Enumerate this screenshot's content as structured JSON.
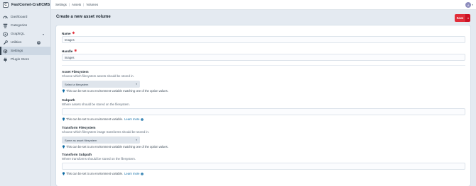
{
  "site": {
    "badge": "C",
    "name": "FastComet-CraftCMS"
  },
  "nav": [
    {
      "label": "Dashboard",
      "icon": "dashboard-icon"
    },
    {
      "label": "Categories",
      "icon": "categories-icon"
    },
    {
      "label": "GraphQL",
      "icon": "graphql-icon"
    },
    {
      "label": "Utilities",
      "icon": "wrench-icon",
      "badge": "3"
    },
    {
      "label": "Settings",
      "icon": "gear-icon"
    },
    {
      "label": "Plugin Store",
      "icon": "plug-icon"
    }
  ],
  "breadcrumbs": [
    "Settings",
    "Assets",
    "Volumes"
  ],
  "user": {
    "initial": "A"
  },
  "page": {
    "title": "Create a new asset volume"
  },
  "actions": {
    "save": "Save"
  },
  "form": {
    "name": {
      "label": "Name",
      "value": "Images"
    },
    "handle": {
      "label": "Handle",
      "value": "images"
    },
    "asset_fs": {
      "label": "Asset Filesystem",
      "instructions": "Choose which filesystem assets should be stored in.",
      "selected": "Select a filesystem",
      "tip": "This can be set to an environment variable matching one of the option values."
    },
    "subpath": {
      "label": "Subpath",
      "instructions": "Where assets should be stored on the filesystem.",
      "value": "",
      "tip": "This can be set to an environment variable.",
      "link": "Learn more"
    },
    "transform_fs": {
      "label": "Transform Filesystem",
      "instructions": "Choose which filesystem image transforms should be stored in.",
      "selected": "Same as asset filesystem",
      "tip": "This can be set to an environment variable matching one of the option values."
    },
    "transform_subpath": {
      "label": "Transform Subpath",
      "instructions": "Where transforms should be stored on the filesystem.",
      "value": "",
      "tip": "This can be set to an environment variable.",
      "link": "Learn more"
    }
  },
  "colors": {
    "accent": "#e12d39",
    "link": "#0b69a3",
    "sidebar": "#e4eaf1"
  }
}
